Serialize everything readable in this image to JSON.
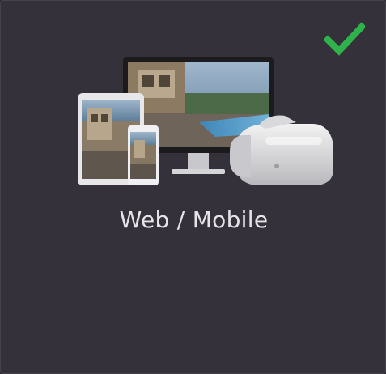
{
  "card": {
    "label": "Web / Mobile",
    "selected": true,
    "check_icon": "checkmark-icon",
    "check_color": "#2fb24c",
    "illustration_icon": "devices-illustration-icon",
    "background_color": "#35313a",
    "text_color": "#e6e4e8"
  }
}
